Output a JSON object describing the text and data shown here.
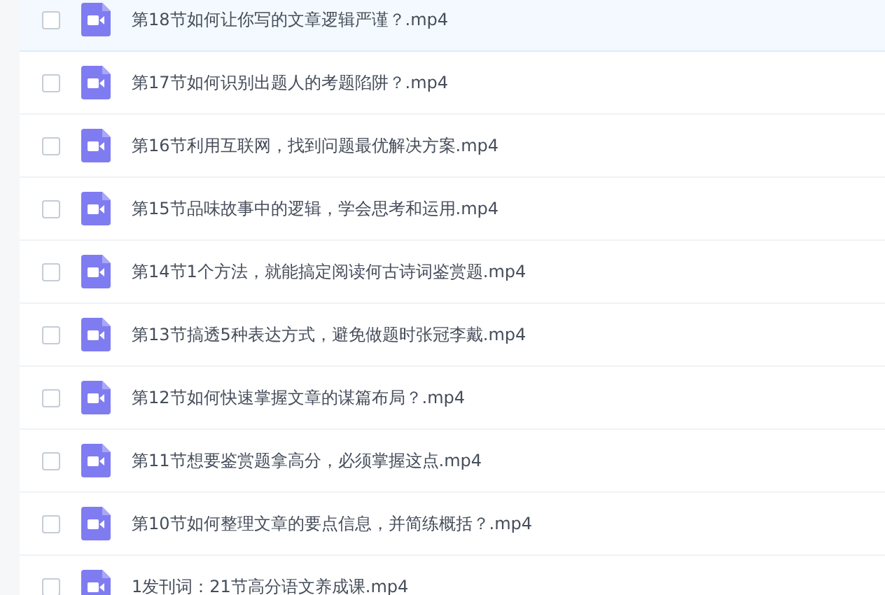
{
  "files": [
    {
      "name": "第18节如何让你写的文章逻辑严谨？.mp4",
      "checked": false,
      "highlighted": true
    },
    {
      "name": "第17节如何识别出题人的考题陷阱？.mp4",
      "checked": false,
      "highlighted": false
    },
    {
      "name": "第16节利用互联网，找到问题最优解决方案.mp4",
      "checked": false,
      "highlighted": false
    },
    {
      "name": "第15节品味故事中的逻辑，学会思考和运用.mp4",
      "checked": false,
      "highlighted": false
    },
    {
      "name": "第14节1个方法，就能搞定阅读何古诗词鉴赏题.mp4",
      "checked": false,
      "highlighted": false
    },
    {
      "name": "第13节搞透5种表达方式，避免做题时张冠李戴.mp4",
      "checked": false,
      "highlighted": false
    },
    {
      "name": "第12节如何快速掌握文章的谋篇布局？.mp4",
      "checked": false,
      "highlighted": false
    },
    {
      "name": "第11节想要鉴赏题拿高分，必须掌握这点.mp4",
      "checked": false,
      "highlighted": false
    },
    {
      "name": "第10节如何整理文章的要点信息，并简练概括？.mp4",
      "checked": false,
      "highlighted": false
    },
    {
      "name": "1发刊词：21节高分语文养成课.mp4",
      "checked": false,
      "highlighted": false
    }
  ]
}
